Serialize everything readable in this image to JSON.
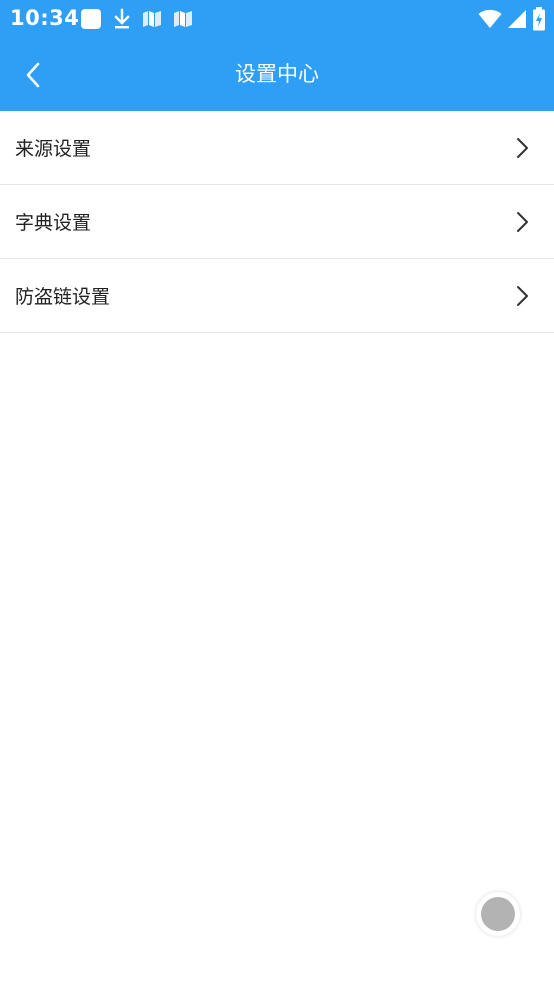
{
  "status_bar": {
    "time": "10:34",
    "background": "#2f9ff5",
    "icons_left": [
      "app-square-icon",
      "download-icon",
      "map-icon",
      "map-icon"
    ],
    "icons_right": [
      "wifi-icon",
      "signal-icon",
      "battery-charging-icon"
    ]
  },
  "header": {
    "title": "设置中心",
    "back_icon": "chevron-left-icon",
    "background": "#2f9ff5"
  },
  "settings": {
    "items": [
      {
        "label": "来源设置"
      },
      {
        "label": "字典设置"
      },
      {
        "label": "防盗链设置"
      }
    ]
  },
  "floating_button": {
    "icon": "floating-ball-icon"
  }
}
